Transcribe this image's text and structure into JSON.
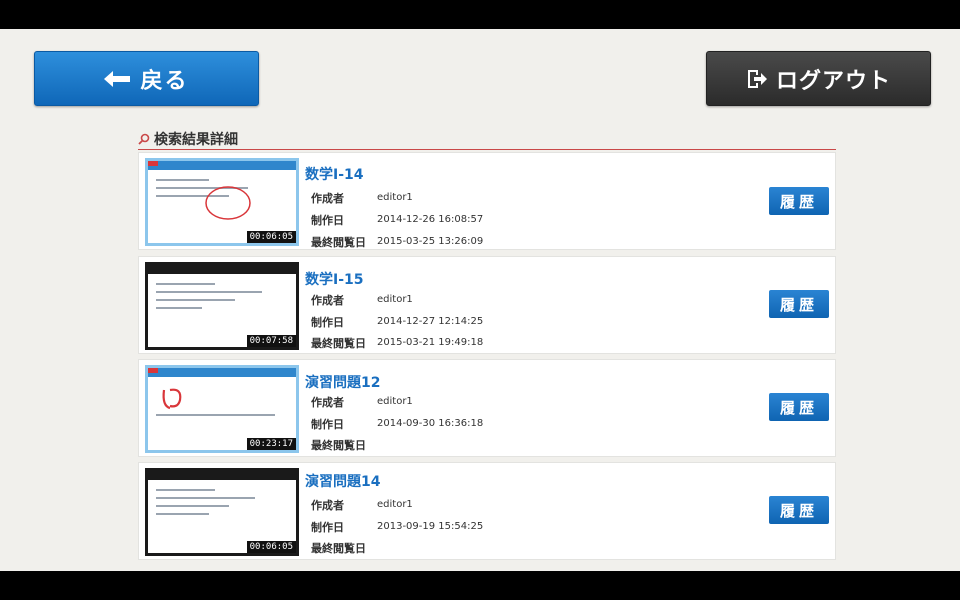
{
  "nav": {
    "back_label": "戻る",
    "logout_label": "ログアウト"
  },
  "section": {
    "title": "検索結果詳細"
  },
  "meta_labels": {
    "author": "作成者",
    "created": "制作日",
    "last_viewed": "最終閲覧日"
  },
  "history_label": "履歴",
  "results": [
    {
      "title": "数学I-14",
      "author": "editor1",
      "created": "2014-12-26 16:08:57",
      "last_viewed": "2015-03-25 13:26:09",
      "duration": "00:06:05"
    },
    {
      "title": "数学I-15",
      "author": "editor1",
      "created": "2014-12-27 12:14:25",
      "last_viewed": "2015-03-21 19:49:18",
      "duration": "00:07:58"
    },
    {
      "title": "演習問題12",
      "author": "editor1",
      "created": "2014-09-30 16:36:18",
      "last_viewed": "",
      "duration": "00:23:17"
    },
    {
      "title": "演習問題14",
      "author": "editor1",
      "created": "2013-09-19 15:54:25",
      "last_viewed": "",
      "duration": "00:06:05"
    }
  ],
  "colors": {
    "accent": "#1a6fc0",
    "back_button": "#1a74c4",
    "logout_button": "#333333",
    "divider": "#c94848"
  }
}
